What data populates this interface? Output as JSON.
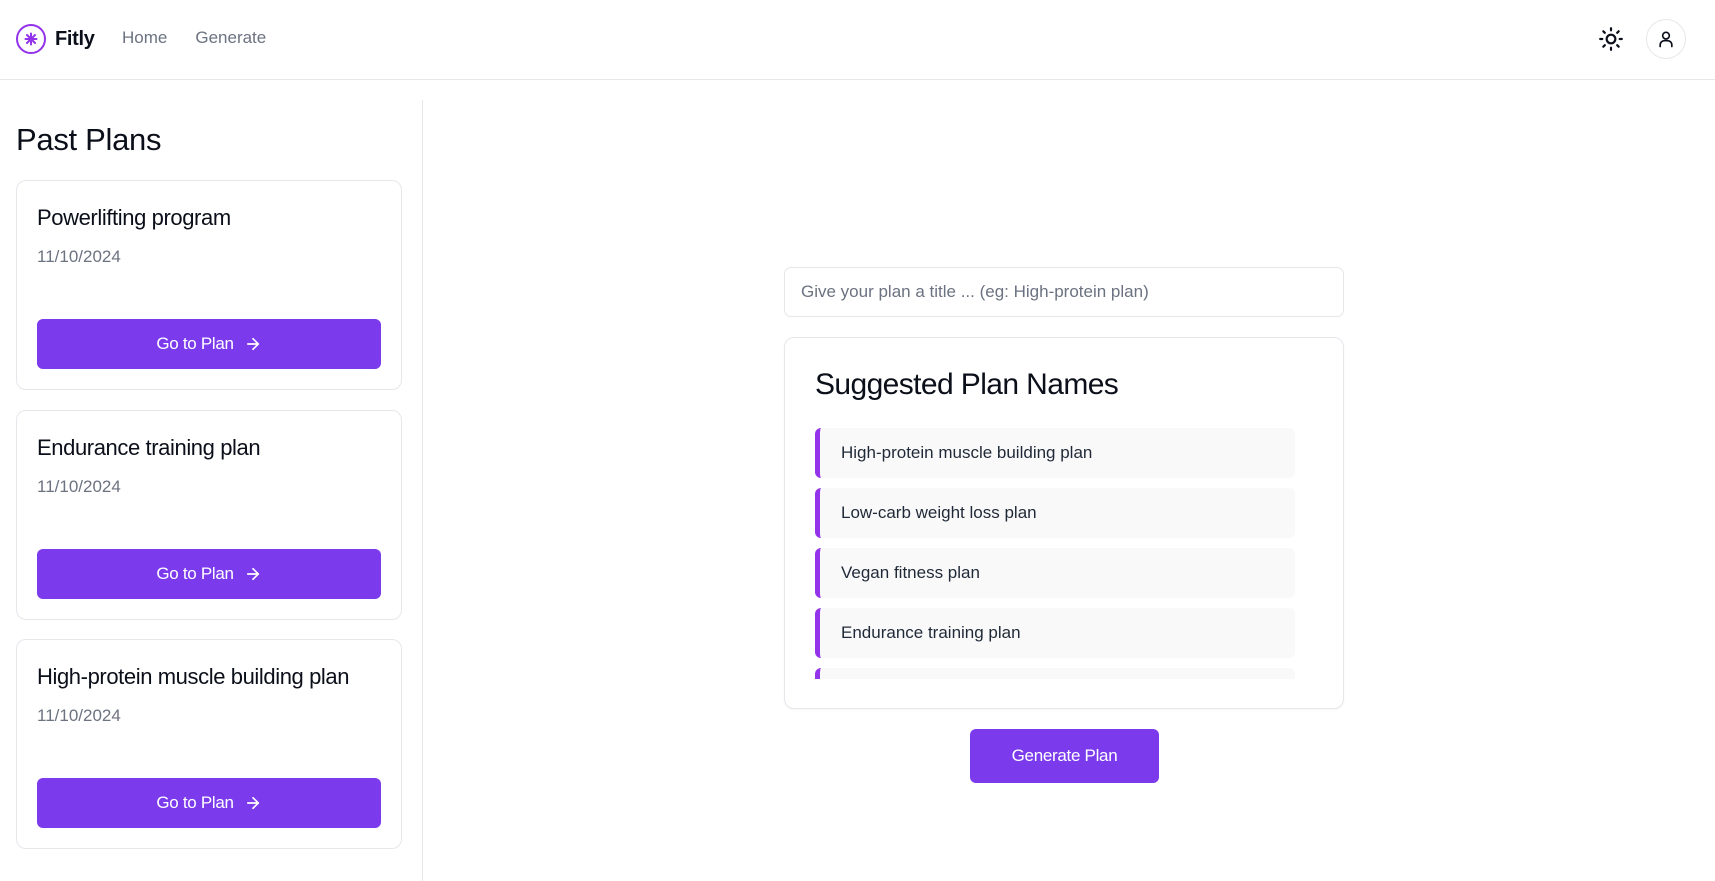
{
  "header": {
    "brand": "Fitly",
    "logo_icon": "sparkle-circle-icon",
    "nav": [
      {
        "label": "Home"
      },
      {
        "label": "Generate"
      }
    ],
    "theme_icon": "sun-icon",
    "user_icon": "user-icon"
  },
  "sidebar": {
    "title": "Past Plans",
    "plans": [
      {
        "title": "Powerlifting program",
        "date": "11/10/2024",
        "button": "Go to Plan"
      },
      {
        "title": "Endurance training plan",
        "date": "11/10/2024",
        "button": "Go to Plan"
      },
      {
        "title": "High-protein muscle building plan",
        "date": "11/10/2024",
        "button": "Go to Plan"
      }
    ]
  },
  "main": {
    "title_input": {
      "value": "",
      "placeholder": "Give your plan a title ... (eg: High-protein plan)"
    },
    "suggestions": {
      "title": "Suggested Plan Names",
      "items": [
        "High-protein muscle building plan",
        "Low-carb weight loss plan",
        "Vegan fitness plan",
        "Endurance training plan",
        ""
      ]
    },
    "generate_button": "Generate Plan"
  },
  "colors": {
    "accent": "#7c3aed",
    "accent_border": "#9333ea",
    "muted_text": "#6b7280",
    "border": "#e5e7eb"
  }
}
